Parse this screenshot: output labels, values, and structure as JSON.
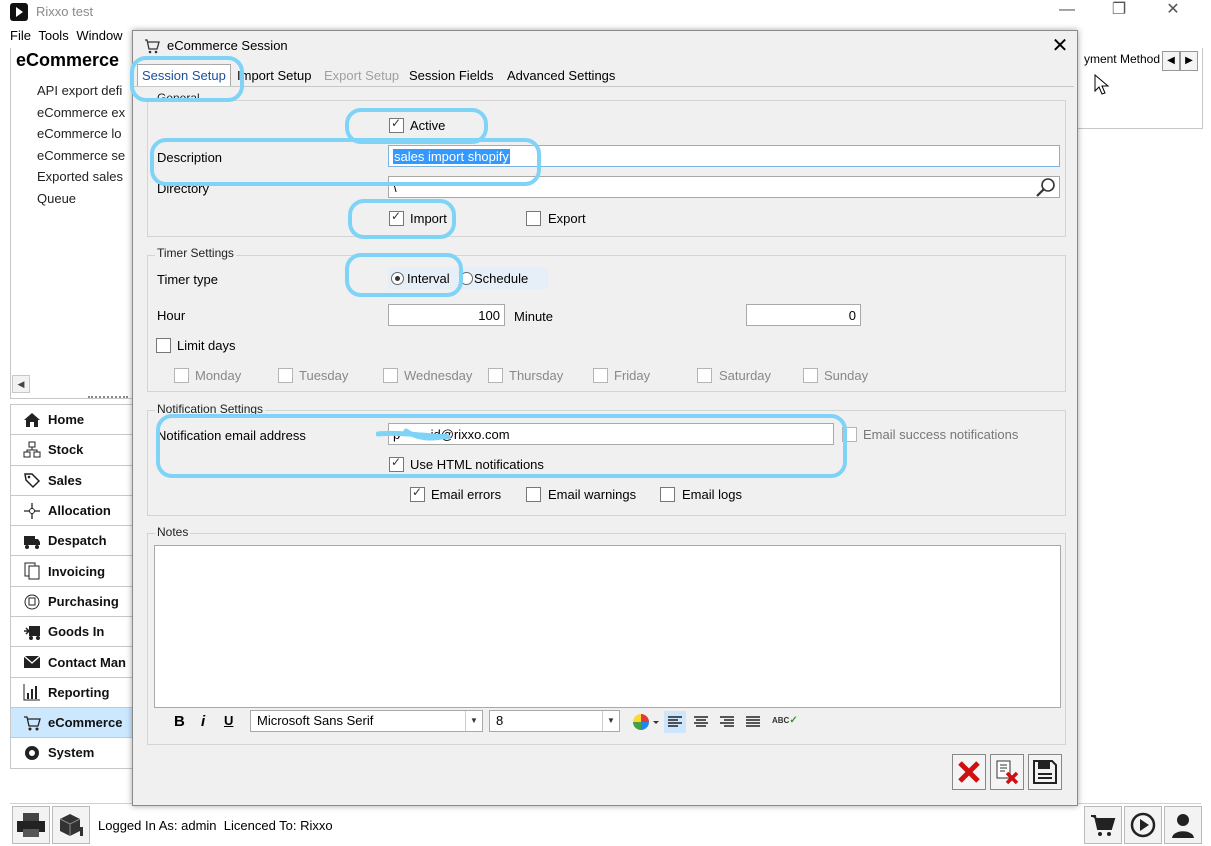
{
  "app": {
    "title": "Rixxo test",
    "window_controls": [
      "—",
      "❐",
      "✕"
    ],
    "menu": [
      "File",
      "Tools",
      "Window"
    ]
  },
  "sidebar": {
    "header": "eCommerce",
    "items": [
      "API export defi",
      "eCommerce ex",
      "eCommerce lo",
      "eCommerce se",
      "Exported sales",
      "Queue"
    ]
  },
  "nav": {
    "items": [
      {
        "label": "Home",
        "icon": "home-icon"
      },
      {
        "label": "Stock",
        "icon": "stock-icon"
      },
      {
        "label": "Sales",
        "icon": "sales-icon"
      },
      {
        "label": "Allocation",
        "icon": "allocation-icon"
      },
      {
        "label": "Despatch",
        "icon": "despatch-icon"
      },
      {
        "label": "Invoicing",
        "icon": "invoicing-icon"
      },
      {
        "label": "Purchasing",
        "icon": "purchasing-icon"
      },
      {
        "label": "Goods In",
        "icon": "goods-in-icon"
      },
      {
        "label": "Contact Man",
        "icon": "contact-icon"
      },
      {
        "label": "Reporting",
        "icon": "reporting-icon"
      },
      {
        "label": "eCommerce",
        "icon": "ecommerce-icon",
        "selected": true
      },
      {
        "label": "System",
        "icon": "system-icon"
      }
    ]
  },
  "right_panel": {
    "column_header": "yment Method",
    "arrow_left": "◀",
    "arrow_right": "▶"
  },
  "status": {
    "logged_in": "Logged In As: admin",
    "licence": "Licenced To: Rixxo"
  },
  "dialog": {
    "title": "eCommerce Session",
    "close": "✕",
    "tabs": [
      {
        "label": "Session Setup",
        "state": "selected"
      },
      {
        "label": "Import Setup",
        "state": "normal"
      },
      {
        "label": "Export Setup",
        "state": "disabled"
      },
      {
        "label": "Session Fields",
        "state": "normal"
      },
      {
        "label": "Advanced Settings",
        "state": "normal"
      }
    ],
    "general": {
      "group_title": "General",
      "active_label": "Active",
      "active_checked": true,
      "description_label": "Description",
      "description_value": "sales import shopify",
      "directory_label": "Directory",
      "directory_value": "\\",
      "import_label": "Import",
      "import_checked": true,
      "export_label": "Export",
      "export_checked": false
    },
    "timer": {
      "group_title": "Timer Settings",
      "timer_type_label": "Timer type",
      "interval_label": "Interval",
      "schedule_label": "Schedule",
      "selected": "Interval",
      "hour_label": "Hour",
      "hour_value": "100",
      "minute_label": "Minute",
      "minute_value": "0",
      "limit_days_label": "Limit days",
      "days": [
        "Monday",
        "Tuesday",
        "Wednesday",
        "Thursday",
        "Friday",
        "Saturday",
        "Sunday"
      ]
    },
    "notification": {
      "group_title": "Notification Settings",
      "email_label": "Notification email address",
      "email_value": "p~~~~id@rixxo.com",
      "email_success_label": "Email success notifications",
      "use_html_label": "Use HTML notifications",
      "use_html_checked": true,
      "email_errors_label": "Email errors",
      "email_errors_checked": true,
      "email_warnings_label": "Email warnings",
      "email_logs_label": "Email logs"
    },
    "notes": {
      "group_title": "Notes",
      "bold": "B",
      "italic": "i",
      "underline": "U",
      "font_value": "Microsoft Sans Serif",
      "size_value": "8",
      "spell_label": "ABC"
    },
    "colors": {
      "highlight": "#7fd3f7",
      "selection": "#3399ff",
      "delete_red": "#d01010"
    }
  }
}
